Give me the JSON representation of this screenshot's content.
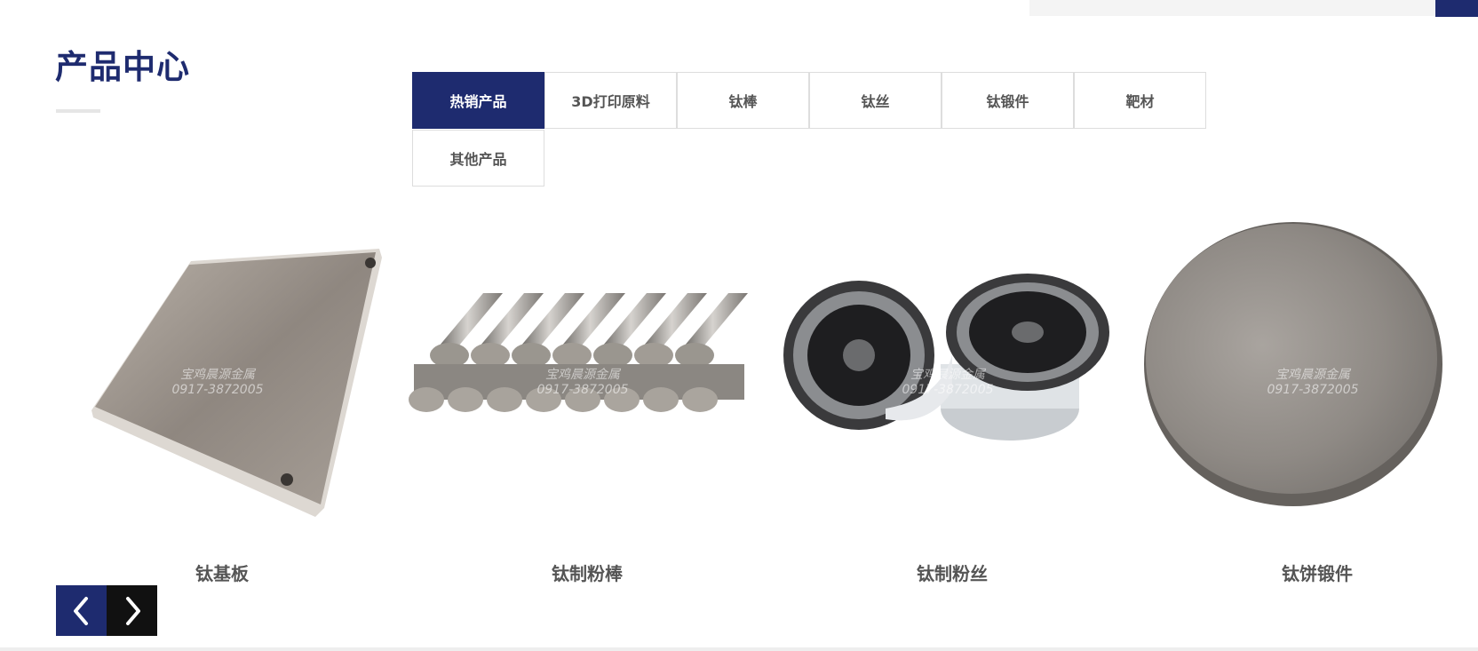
{
  "section": {
    "title": "产品中心"
  },
  "tabs": [
    {
      "label": "热销产品",
      "active": true
    },
    {
      "label": "3D打印原料",
      "active": false
    },
    {
      "label": "钛棒",
      "active": false
    },
    {
      "label": "钛丝",
      "active": false
    },
    {
      "label": "钛锻件",
      "active": false
    },
    {
      "label": "靶材",
      "active": false
    },
    {
      "label": "其他产品",
      "active": false
    }
  ],
  "products": [
    {
      "name": "钛基板",
      "watermark_line1": "宝鸡晨源金属",
      "watermark_line2": "0917-3872005"
    },
    {
      "name": "钛制粉棒",
      "watermark_line1": "宝鸡晨源金属",
      "watermark_line2": "0917-3872005"
    },
    {
      "name": "钛制粉丝",
      "watermark_line1": "宝鸡晨源金属",
      "watermark_line2": "0917-3872005"
    },
    {
      "name": "钛饼锻件",
      "watermark_line1": "宝鸡晨源金属",
      "watermark_line2": "0917-3872005"
    }
  ],
  "carousel": {
    "prev_icon": "chevron-left-icon",
    "next_icon": "chevron-right-icon"
  },
  "colors": {
    "brand": "#1e2b6f",
    "dark": "#111111",
    "text": "#555555"
  }
}
